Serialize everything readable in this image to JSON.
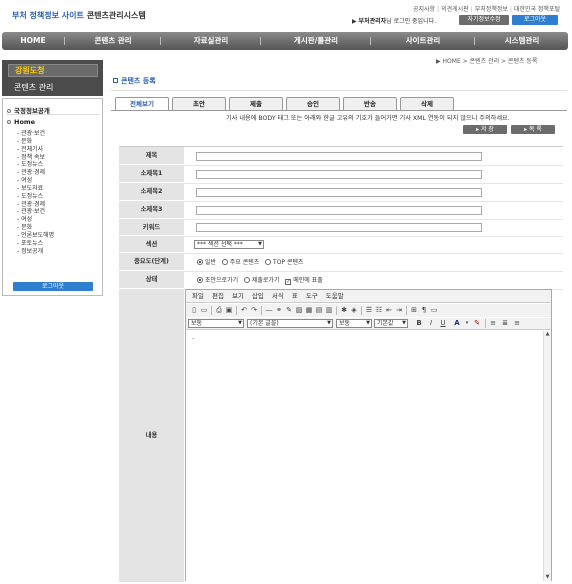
{
  "header": {
    "site_title_blue": "부처 정책정보 사이트",
    "site_title_dark": "콘텐츠관리시스템",
    "top_links": [
      "공지사항",
      "의견게시판",
      "부처정책정보",
      "대한민국 정책포털"
    ],
    "login_user": "부처관리자",
    "login_suffix": "님 로그인 중입니다.",
    "btn_user_info": "자기정보수정",
    "btn_logout": "로그아웃"
  },
  "nav": {
    "items": [
      "HOME",
      "콘텐츠 관리",
      "자료실관리",
      "게시판/툴관리",
      "사이트관리",
      "시스템관리"
    ]
  },
  "breadcrumb": "HOME > 콘텐츠 관리 > 콘텐츠 등록",
  "sidebar": {
    "region": "강원도청",
    "section": "콘텐츠 관리",
    "root1": "국정정보공개",
    "root2": "Home",
    "items": [
      "관광·보건",
      "문화",
      "전체기사",
      "정책 속보",
      "도정뉴스",
      "관광·경제",
      "여성",
      "보도자료",
      "도정뉴스",
      "관광·경제",
      "관광·보건",
      "여성",
      "문화",
      "언론보도해명",
      "포토뉴스",
      "정보공개"
    ],
    "logout": "로그아웃"
  },
  "main": {
    "title": "콘텐츠 등록",
    "tabs": [
      "전체보기",
      "초안",
      "제출",
      "승인",
      "반송",
      "삭제"
    ],
    "notice": "기사 내용에 BODY 태그 또는 아래와 한글 고유의 기호가 들어가면 기사 XML 연동이 되지 않으니 주의하세요.",
    "btn_save": "저 장",
    "btn_list": "목 록"
  },
  "form": {
    "labels": {
      "title": "제목",
      "sub1": "소제목1",
      "sub2": "소제목2",
      "sub3": "소제목3",
      "keyword": "키워드",
      "section": "섹션",
      "importance": "중요도(단계)",
      "status": "상태",
      "content": "내용"
    },
    "section_select": "*** 섹션 선택 ***",
    "importance_options": [
      "일반",
      "주요 콘텐츠",
      "TOP 콘텐츠"
    ],
    "status_options": [
      "초안으로가기",
      "제출로가기"
    ],
    "status_checkbox": "메인에 표출"
  },
  "editor": {
    "menu": [
      "파일",
      "편집",
      "보기",
      "삽입",
      "서식",
      "표",
      "도구",
      "도움말"
    ],
    "style_select": "보통",
    "font_select": "(기본 글꼴)",
    "size_select": "보통",
    "size2_select": "기본값",
    "content": "."
  }
}
